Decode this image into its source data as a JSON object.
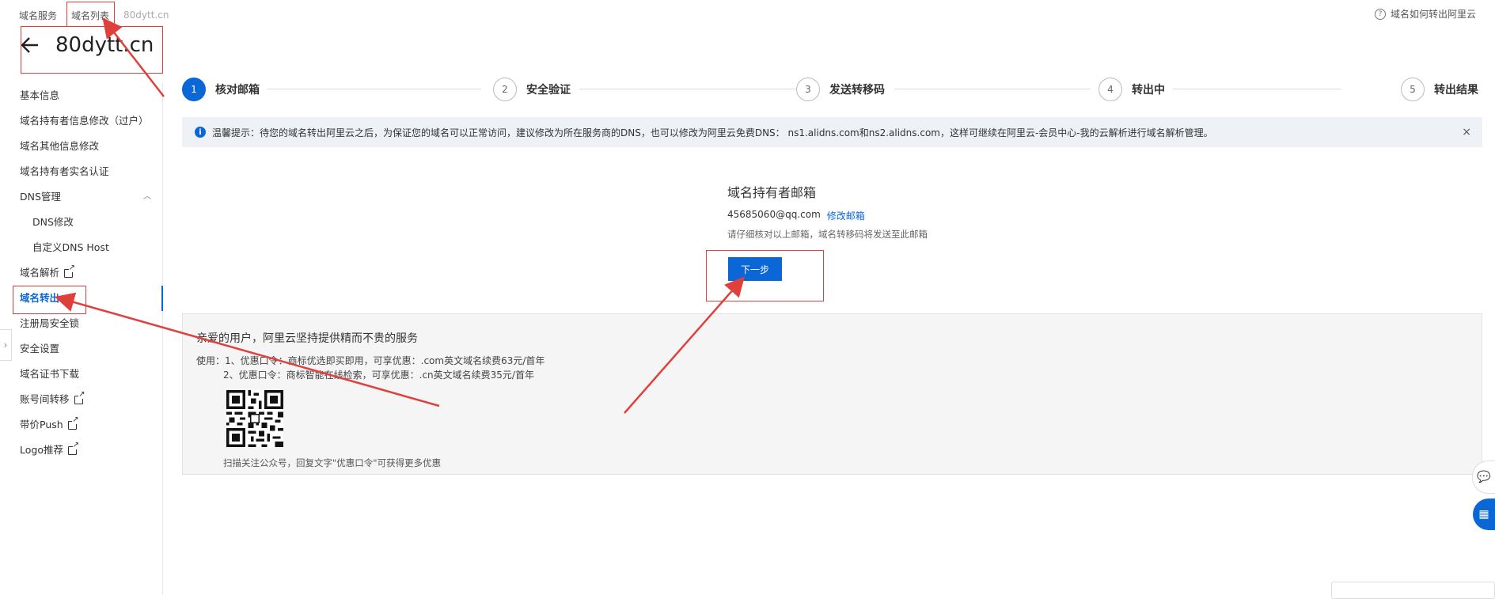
{
  "breadcrumb": [
    "域名服务",
    "域名列表",
    "80dytt.cn"
  ],
  "help_link": "域名如何转出阿里云",
  "page_title": "80dytt.cn",
  "sidebar": {
    "items": [
      {
        "label": "基本信息"
      },
      {
        "label": "域名持有者信息修改（过户）"
      },
      {
        "label": "域名其他信息修改"
      },
      {
        "label": "域名持有者实名认证"
      },
      {
        "label": "DNS管理",
        "expanded": true
      },
      {
        "label": "DNS修改",
        "sub": true
      },
      {
        "label": "自定义DNS Host",
        "sub": true
      },
      {
        "label": "域名解析",
        "external": true
      },
      {
        "label": "域名转出",
        "active": true
      },
      {
        "label": "注册局安全锁"
      },
      {
        "label": "安全设置"
      },
      {
        "label": "域名证书下载"
      },
      {
        "label": "账号间转移",
        "external": true
      },
      {
        "label": "带价Push",
        "external": true
      },
      {
        "label": "Logo推荐",
        "external": true
      }
    ]
  },
  "steps": [
    {
      "num": "1",
      "label": "核对邮箱",
      "current": true
    },
    {
      "num": "2",
      "label": "安全验证"
    },
    {
      "num": "3",
      "label": "发送转移码"
    },
    {
      "num": "4",
      "label": "转出中"
    },
    {
      "num": "5",
      "label": "转出结果"
    }
  ],
  "notice": {
    "text": "温馨提示：待您的域名转出阿里云之后，为保证您的域名可以正常访问，建议修改为所在服务商的DNS，也可以修改为阿里云免费DNS： ns1.alidns.com和ns2.alidns.com，这样可继续在阿里云-会员中心-我的云解析进行域名解析管理。",
    "close": "×"
  },
  "email": {
    "title": "域名持有者邮箱",
    "address": "45685060@qq.com",
    "modify_link": "修改邮箱",
    "hint": "请仔细核对以上邮箱，域名转移码将发送至此邮箱"
  },
  "next_button": "下一步",
  "promo": {
    "title": "亲爱的用户，阿里云坚持提供精而不贵的服务",
    "line1": "使用：1、优惠口令：商标优选即买即用，可享优惠：.com英文域名续费63元/首年",
    "line2": "2、优惠口令：商标智能在线检索，可享优惠：.cn英文域名续费35元/首年",
    "qr_caption": "扫描关注公众号，回复文字\"优惠口令\"可获得更多优惠"
  },
  "colors": {
    "accent": "#0b66d6",
    "annotation": "#e0403c"
  }
}
